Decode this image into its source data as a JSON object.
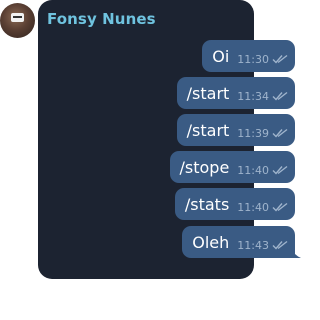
{
  "chat": {
    "sender_name": "Fonsy Nunes",
    "avatar": "contact-avatar",
    "messages": [
      {
        "text": "Oi",
        "time": "11:30",
        "status_icon": "double-check-icon"
      },
      {
        "text": "/start",
        "time": "11:34",
        "status_icon": "double-check-icon"
      },
      {
        "text": "/start",
        "time": "11:39",
        "status_icon": "double-check-icon"
      },
      {
        "text": "/stope",
        "time": "11:40",
        "status_icon": "double-check-icon"
      },
      {
        "text": "/stats",
        "time": "11:40",
        "status_icon": "double-check-icon"
      },
      {
        "text": "Oleh",
        "time": "11:43",
        "status_icon": "double-check-icon"
      }
    ]
  },
  "colors": {
    "panel_bg": "#1c2331",
    "bubble_bg": "#3a5b84",
    "sender_name": "#6fc3df",
    "time_text": "#9fb4cc"
  }
}
